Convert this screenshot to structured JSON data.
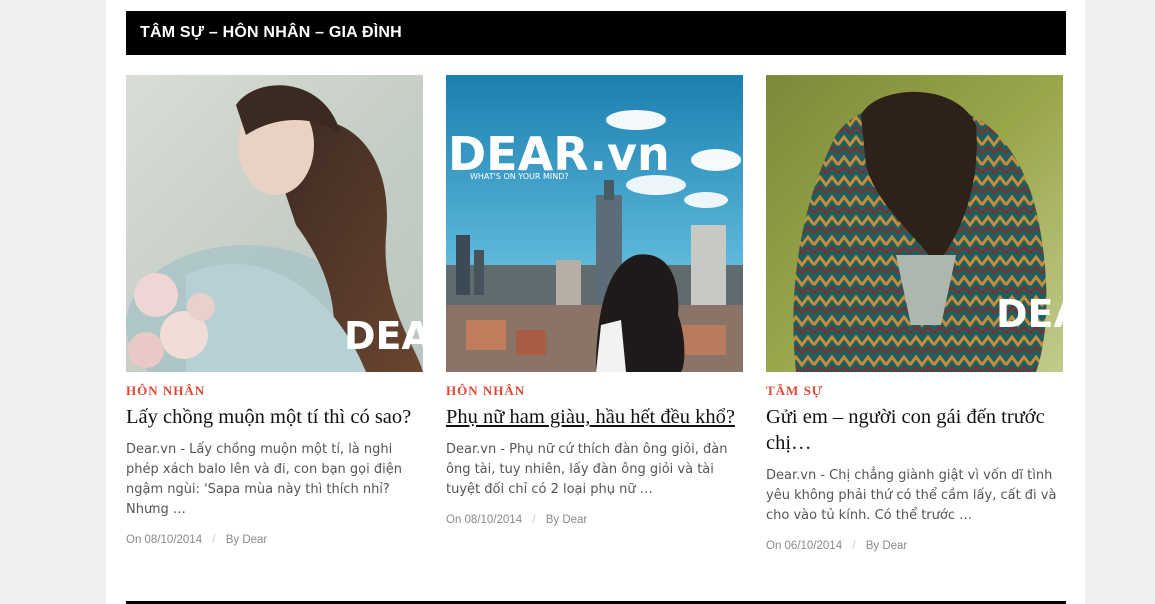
{
  "section": {
    "title": "TÂM SỰ – HÔN NHÂN – GIA ĐÌNH"
  },
  "brand": {
    "watermark": "DEAR",
    "watermark_full": "DEAR.vn",
    "tagline": "WHAT'S ON YOUR MIND?"
  },
  "posts": [
    {
      "category": "HÔN NHÂN",
      "title": "Lấy chồng muộn một tí thì có sao?",
      "excerpt": "Dear.vn - Lấy chồng muộn một tí, là nghi phép xách balo lên và đi, con bạn gọi điện ngậm ngùi: 'Sapa mùa này thì thích nhỉ? Nhưng …",
      "date": "On 08/10/2014",
      "author": "By Dear"
    },
    {
      "category": "HÔN NHÂN",
      "title": "Phụ nữ ham giàu, hầu hết đều khổ?",
      "excerpt": "Dear.vn - Phụ nữ cứ thích đàn ông giỏi, đàn ông tài, tuy nhiên, lấy đàn ông giỏi và tài tuyệt đối chỉ có 2 loại phụ nữ …",
      "date": "On 08/10/2014",
      "author": "By Dear"
    },
    {
      "category": "TÂM SỰ",
      "title": "Gửi em – người con gái đến trước chị…",
      "excerpt": "Dear.vn - Chị chẳng giành giật vì vốn dĩ tình yêu không phải thứ có thể cầm lấy, cất đi và cho vào tủ kính. Có thể trước …",
      "date": "On 06/10/2014",
      "author": "By Dear"
    }
  ],
  "colors": {
    "accent": "#e04a35",
    "header_bg": "#000000"
  }
}
